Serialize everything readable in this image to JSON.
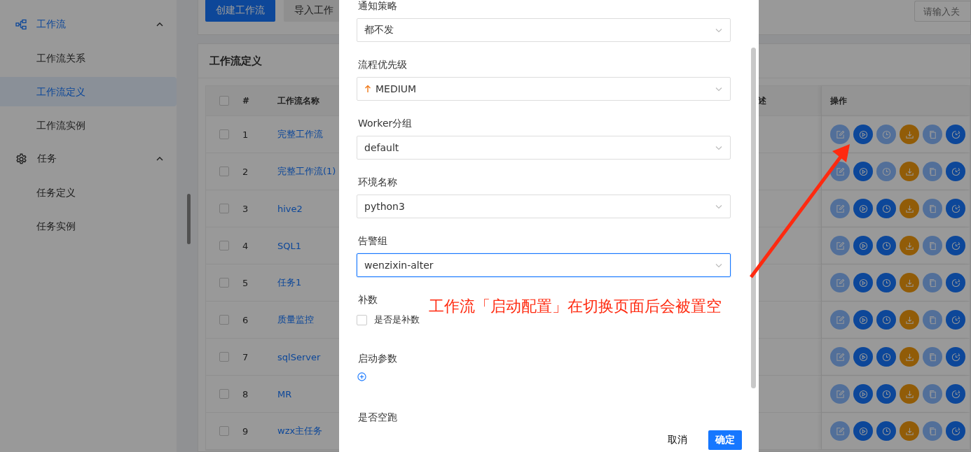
{
  "sidebar": {
    "groups": [
      {
        "label": "工作流",
        "expanded": true,
        "children": [
          {
            "label": "工作流关系",
            "selected": false
          },
          {
            "label": "工作流定义",
            "selected": true
          },
          {
            "label": "工作流实例",
            "selected": false
          }
        ]
      },
      {
        "label": "任务",
        "expanded": true,
        "children": [
          {
            "label": "任务定义",
            "selected": false
          },
          {
            "label": "任务实例",
            "selected": false
          }
        ]
      }
    ]
  },
  "toolbar": {
    "buttons": [
      {
        "label": "创建工作流",
        "kind": "primary"
      },
      {
        "label": "导入工作",
        "kind": "default"
      }
    ],
    "search": {
      "placeholder": "请输入关"
    }
  },
  "table": {
    "title": "工作流定义",
    "columns": [
      "#",
      "工作流名称",
      "述",
      "操作"
    ],
    "header_checked": false,
    "rows": [
      {
        "checked": false,
        "index": "1",
        "name": "完整工作流",
        "actions": [
          {
            "kind": "edit",
            "disabled": true
          },
          {
            "kind": "start",
            "disabled": false
          },
          {
            "kind": "timing",
            "disabled": true
          },
          {
            "kind": "export",
            "disabled": false
          },
          {
            "kind": "copy",
            "disabled": true
          },
          {
            "kind": "version",
            "disabled": false
          }
        ]
      },
      {
        "checked": false,
        "index": "2",
        "name": "完整工作流(1)",
        "actions": [
          {
            "kind": "edit",
            "disabled": true
          },
          {
            "kind": "start",
            "disabled": false
          },
          {
            "kind": "timing",
            "disabled": true
          },
          {
            "kind": "export",
            "disabled": false
          },
          {
            "kind": "copy",
            "disabled": true
          },
          {
            "kind": "version",
            "disabled": false
          }
        ]
      },
      {
        "checked": false,
        "index": "3",
        "name": "hive2",
        "actions": [
          {
            "kind": "edit",
            "disabled": true
          },
          {
            "kind": "start",
            "disabled": false
          },
          {
            "kind": "timing",
            "disabled": false
          },
          {
            "kind": "export",
            "disabled": false
          },
          {
            "kind": "copy",
            "disabled": true
          },
          {
            "kind": "version",
            "disabled": false
          }
        ]
      },
      {
        "checked": false,
        "index": "4",
        "name": "SQL1",
        "actions": [
          {
            "kind": "edit",
            "disabled": true
          },
          {
            "kind": "start",
            "disabled": false
          },
          {
            "kind": "timing",
            "disabled": false
          },
          {
            "kind": "export",
            "disabled": false
          },
          {
            "kind": "copy",
            "disabled": true
          },
          {
            "kind": "version",
            "disabled": false
          }
        ]
      },
      {
        "checked": false,
        "index": "5",
        "name": "任务1",
        "actions": [
          {
            "kind": "edit",
            "disabled": true
          },
          {
            "kind": "start",
            "disabled": false
          },
          {
            "kind": "timing",
            "disabled": false
          },
          {
            "kind": "export",
            "disabled": false
          },
          {
            "kind": "copy",
            "disabled": true
          },
          {
            "kind": "version",
            "disabled": false
          }
        ]
      },
      {
        "checked": false,
        "index": "6",
        "name": "质量监控",
        "actions": [
          {
            "kind": "edit",
            "disabled": true
          },
          {
            "kind": "start",
            "disabled": false
          },
          {
            "kind": "timing",
            "disabled": false
          },
          {
            "kind": "export",
            "disabled": false
          },
          {
            "kind": "copy",
            "disabled": true
          },
          {
            "kind": "version",
            "disabled": false
          }
        ]
      },
      {
        "checked": false,
        "index": "7",
        "name": "sqlServer",
        "actions": [
          {
            "kind": "edit",
            "disabled": true
          },
          {
            "kind": "start",
            "disabled": false
          },
          {
            "kind": "timing",
            "disabled": false
          },
          {
            "kind": "export",
            "disabled": false
          },
          {
            "kind": "copy",
            "disabled": true
          },
          {
            "kind": "version",
            "disabled": false
          }
        ]
      },
      {
        "checked": false,
        "index": "8",
        "name": "MR",
        "actions": [
          {
            "kind": "edit",
            "disabled": true
          },
          {
            "kind": "start",
            "disabled": false
          },
          {
            "kind": "timing",
            "disabled": false
          },
          {
            "kind": "export",
            "disabled": false
          },
          {
            "kind": "copy",
            "disabled": true
          },
          {
            "kind": "version",
            "disabled": false
          }
        ]
      },
      {
        "checked": false,
        "index": "9",
        "name": "wzx主任务",
        "actions": [
          {
            "kind": "edit",
            "disabled": true
          },
          {
            "kind": "start",
            "disabled": false
          },
          {
            "kind": "timing",
            "disabled": false
          },
          {
            "kind": "export",
            "disabled": false
          },
          {
            "kind": "copy",
            "disabled": true
          },
          {
            "kind": "version",
            "disabled": false
          }
        ]
      }
    ]
  },
  "dialog": {
    "fields": [
      {
        "kind": "select",
        "label": "通知策略",
        "value": "都不发",
        "focused": false
      },
      {
        "kind": "priority-select",
        "label": "流程优先级",
        "value": "MEDIUM",
        "focused": false
      },
      {
        "kind": "select",
        "label": "Worker分组",
        "value": "default",
        "focused": false
      },
      {
        "kind": "select",
        "label": "环境名称",
        "value": "python3",
        "focused": false
      },
      {
        "kind": "select",
        "label": "告警组",
        "value": "wenzixin-alter",
        "focused": true
      },
      {
        "kind": "checkbox",
        "label": "补数",
        "option": "是否是补数",
        "checked": false
      },
      {
        "kind": "add",
        "label": "启动参数"
      },
      {
        "kind": "label",
        "label": "是否空跑"
      }
    ],
    "buttons": [
      {
        "label": "取消",
        "kind": "default"
      },
      {
        "label": "确定",
        "kind": "primary"
      }
    ]
  },
  "annotation": {
    "text": "工作流「启动配置」在切换页面后会被置空"
  }
}
